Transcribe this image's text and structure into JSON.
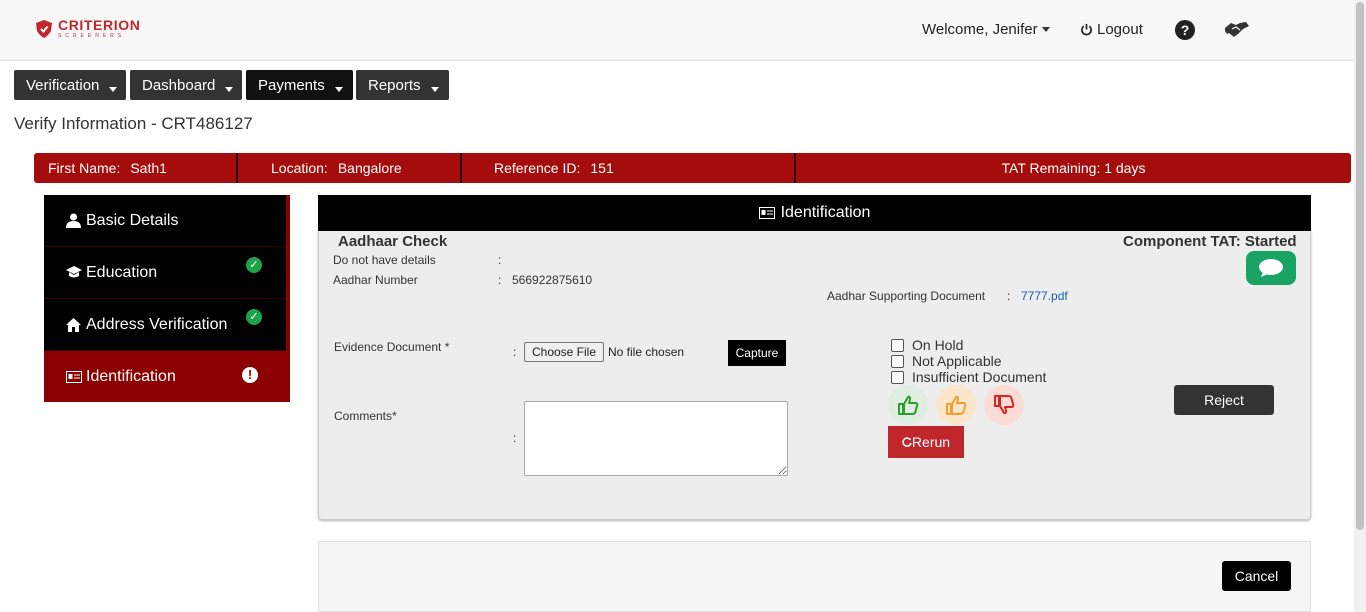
{
  "header": {
    "brand": "CRITERION",
    "brand_sub": "SCREENERS",
    "welcome": "Welcome, Jenifer",
    "logout": "Logout"
  },
  "nav": {
    "items": [
      {
        "label": "Verification"
      },
      {
        "label": "Dashboard"
      },
      {
        "label": "Payments"
      },
      {
        "label": "Reports"
      }
    ]
  },
  "page": {
    "title": "Verify Information - CRT486127"
  },
  "infobar": {
    "first_name_label": "First Name:",
    "first_name": "Sath1",
    "location_label": "Location:",
    "location": "Bangalore",
    "reference_label": "Reference ID:",
    "reference": "151",
    "tat": "TAT Remaining: 1 days"
  },
  "sidebar": {
    "items": [
      {
        "label": "Basic Details",
        "icon": "user-icon",
        "status": ""
      },
      {
        "label": "Education",
        "icon": "graduation-cap-icon",
        "status": "complete"
      },
      {
        "label": "Address Verification",
        "icon": "home-icon",
        "status": "complete"
      },
      {
        "label": "Identification",
        "icon": "id-card-icon",
        "status": "alert"
      }
    ]
  },
  "panel": {
    "header": "Identification",
    "section_title": "Aadhaar Check",
    "component_tat": "Component TAT: Started",
    "fields": {
      "no_details_label": "Do not have details",
      "aadhar_number_label": "Aadhar Number",
      "aadhar_number": "566922875610",
      "supporting_doc_label": "Aadhar Supporting Document",
      "supporting_doc": "7777.pdf",
      "evidence_label": "Evidence Document *",
      "choose_file": "Choose File",
      "no_file": "No file chosen",
      "capture": "Capture",
      "comments_label": "Comments*",
      "colon": ":"
    },
    "checkboxes": [
      {
        "label": "On Hold",
        "checked": false
      },
      {
        "label": "Not Applicable",
        "checked": false
      },
      {
        "label": "Insufficient Document",
        "checked": false
      }
    ],
    "rerun": "Rerun",
    "reject": "Reject"
  },
  "footer": {
    "cancel": "Cancel"
  },
  "colors": {
    "brand_red": "#c0282d",
    "info_bar": "#a50d0d",
    "sidebar_active": "#8b0000",
    "chat_green": "#19a463",
    "thumb_green": "#2a9d2a",
    "thumb_orange": "#f0a030",
    "thumb_red": "#d22"
  }
}
